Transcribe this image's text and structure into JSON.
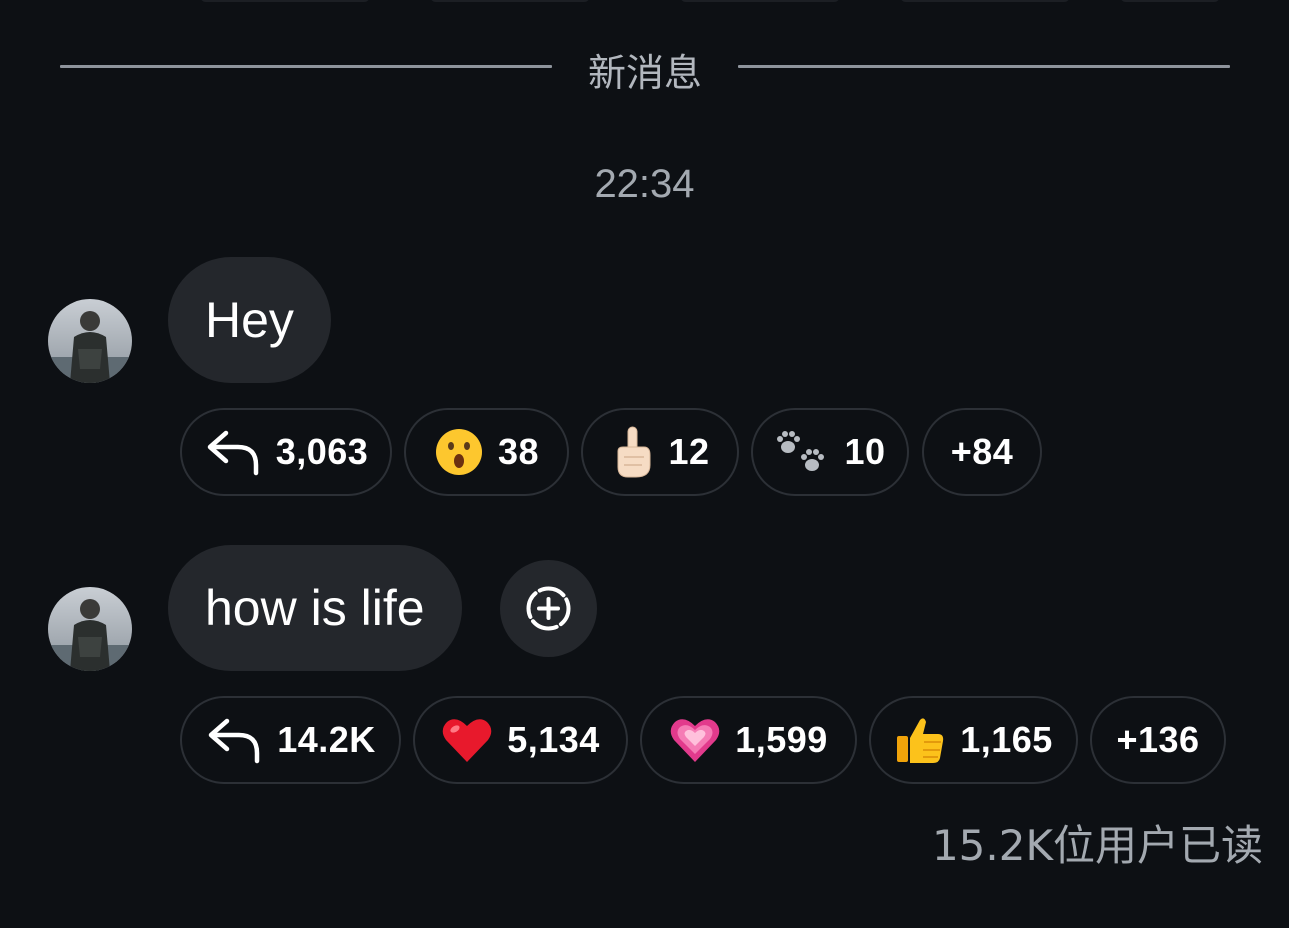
{
  "divider": {
    "label": "新消息"
  },
  "timestamp": "22:34",
  "messages": [
    {
      "text": "Hey",
      "reactions": {
        "replies": "3,063",
        "items": [
          {
            "icon": "astonished-face-icon",
            "count": "38"
          },
          {
            "icon": "pointing-up-finger-icon",
            "count": "12"
          },
          {
            "icon": "paw-prints-icon",
            "count": "10"
          }
        ],
        "more": "+84"
      }
    },
    {
      "text": "how is life",
      "reactions": {
        "replies": "14.2K",
        "items": [
          {
            "icon": "red-heart-icon",
            "count": "5,134"
          },
          {
            "icon": "sparkling-pink-heart-icon",
            "count": "1,599"
          },
          {
            "icon": "thumbs-up-icon",
            "count": "1,165"
          }
        ],
        "more": "+136"
      }
    }
  ],
  "read_status": "15.2K位用户已读",
  "colors": {
    "background": "#0d1014",
    "bubble": "#24272c",
    "chip_border": "#2c3036",
    "muted_text": "#a3a9b0"
  }
}
